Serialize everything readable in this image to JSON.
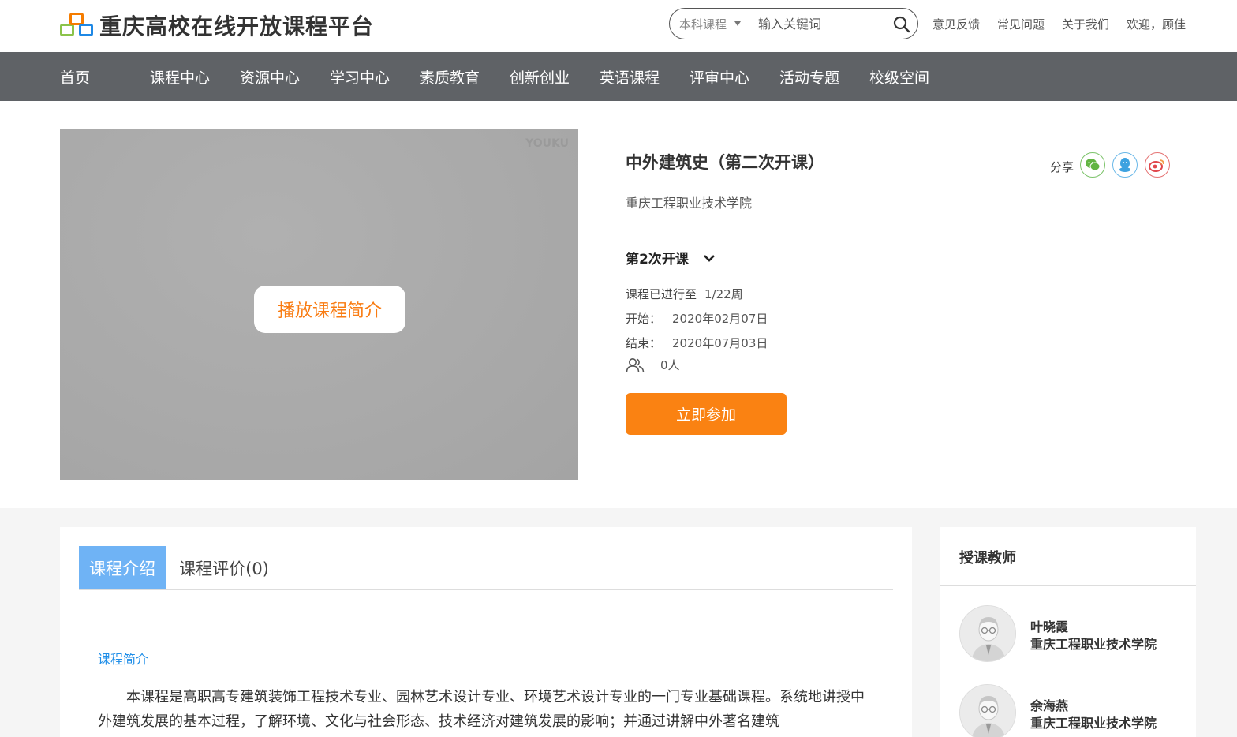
{
  "header": {
    "logo_text": "重庆高校在线开放课程平台",
    "search": {
      "category": "本科课程",
      "placeholder": "输入关键词"
    },
    "links": [
      "意见反馈",
      "常见问题",
      "关于我们",
      "欢迎，顾佳"
    ]
  },
  "nav": {
    "items": [
      "首页",
      "课程中心",
      "资源中心",
      "学习中心",
      "素质教育",
      "创新创业",
      "英语课程",
      "评审中心",
      "活动专题",
      "校级空间"
    ]
  },
  "course": {
    "video_watermark": "YOUKU",
    "play_label": "播放课程简介",
    "title": "中外建筑史（第二次开课）",
    "school": "重庆工程职业技术学院",
    "share_label": "分享",
    "session": "第2次开课",
    "progress_label": "课程已进行至",
    "progress_value": "1/22周",
    "start_label": "开始：",
    "start_value": "2020年02月07日",
    "end_label": "结束：",
    "end_value": "2020年07月03日",
    "enrolled": "0人",
    "join_label": "立即参加"
  },
  "tabs": {
    "intro": "课程介绍",
    "reviews": "课程评价(0)"
  },
  "intro": {
    "section_title": "课程简介",
    "text": "本课程是高职高专建筑装饰工程技术专业、园林艺术设计专业、环境艺术设计专业的一门专业基础课程。系统地讲授中外建筑发展的基本过程，了解环境、文化与社会形态、技术经济对建筑发展的影响；并通过讲解中外著名建筑"
  },
  "teachers": {
    "title": "授课教师",
    "list": [
      {
        "name": "叶晓霞",
        "school": "重庆工程职业技术学院"
      },
      {
        "name": "余海燕",
        "school": "重庆工程职业技术学院"
      }
    ]
  },
  "colors": {
    "nav_bg": "#5f6266",
    "accent_orange": "#fa8212",
    "tab_active": "#6fb3f5",
    "link_blue": "#1f8ee8"
  }
}
